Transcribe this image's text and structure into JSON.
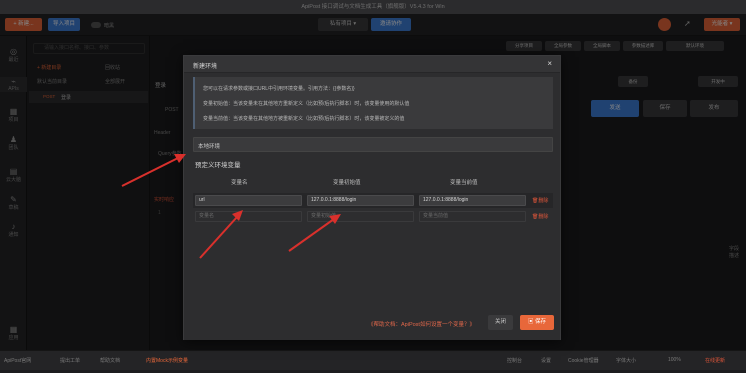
{
  "window": {
    "title": "ApiPost 接口调试与文档生成工具（旗舰版）V5.4.3 for Win"
  },
  "toolbar": {
    "new_label": "+ 新建...",
    "import_label": "导入项目",
    "theme_label": "暗黑",
    "project_label": "私有项目",
    "invite_label": "邀请协作",
    "user_label": "光能者"
  },
  "leftnav": [
    {
      "icon": "globe-icon",
      "label": "最近"
    },
    {
      "icon": "api-icon",
      "label": "APIs"
    },
    {
      "icon": "grid-icon",
      "label": "项目"
    },
    {
      "icon": "team-icon",
      "label": "团队"
    },
    {
      "icon": "doc-icon",
      "label": "云大脑"
    },
    {
      "icon": "edit-icon",
      "label": "草稿"
    },
    {
      "icon": "bell-icon",
      "label": "通知"
    },
    {
      "icon": "apps-icon",
      "label": "应用"
    }
  ],
  "sidebar": {
    "search_placeholder": "请输入接口名称、接口、参数",
    "new_dir": "+ 新建目录",
    "recycle": "回收站",
    "root": "默认当前目录",
    "expand_all": "全部展开",
    "api_method": "POST",
    "api_name": "登录"
  },
  "main": {
    "share_project": "分享项目",
    "global_params": "全局参数",
    "global_scripts": "全局脚本",
    "params_desc": "参数描述库",
    "env_select": "默认环境",
    "tab_name": "登录",
    "send": "发送",
    "save": "保存",
    "publish": "发布",
    "mock": "锁定",
    "backup": "备份",
    "developing": "开发中",
    "header_tab": "Header",
    "query_tab": "Query参数",
    "request_label": "实时响应",
    "response_label": "实时响应",
    "line_no": "1",
    "right_panel": "字段描述"
  },
  "modal": {
    "title": "新建环境",
    "info_lines": [
      "您可以在请求参数或接口URL中引用环境变量。引用方法：{{参数名}}",
      "变量初始值：当该变量未在其他地方重新定义（比如预/后执行脚本）时，该变量使用的默认值",
      "变量当前值：当该变量在其他地方被重新定义（比如预/后执行脚本）时，该变量被定义的值"
    ],
    "env_name": "本地环境",
    "section_title": "预定义环境变量",
    "columns": [
      "变量名",
      "变量初始值",
      "变量当前值"
    ],
    "rows": [
      {
        "name": "url",
        "initial": "127.0.0.1:8888/login",
        "current": "127.0.0.1:8888/login",
        "delete": "删除"
      }
    ],
    "new_row": {
      "name": "变量名",
      "initial": "变量初始值",
      "current": "变量当前值",
      "delete": "删除"
    },
    "help_link": "《帮助文档：ApiPost如何设置一个变量？》",
    "close_label": "关闭",
    "save_label": "保存"
  },
  "statusbar": {
    "left": [
      "ApiPost官网",
      "提出工单",
      "帮助文档",
      "内置Mock示例变量"
    ],
    "right": [
      "控制台",
      "设置",
      "Cookie管理器",
      "字体大小",
      "100%",
      "在线更新"
    ]
  },
  "colors": {
    "accent": "#e8673a",
    "arrow": "#d9302c",
    "primary": "#3f7fd9"
  }
}
